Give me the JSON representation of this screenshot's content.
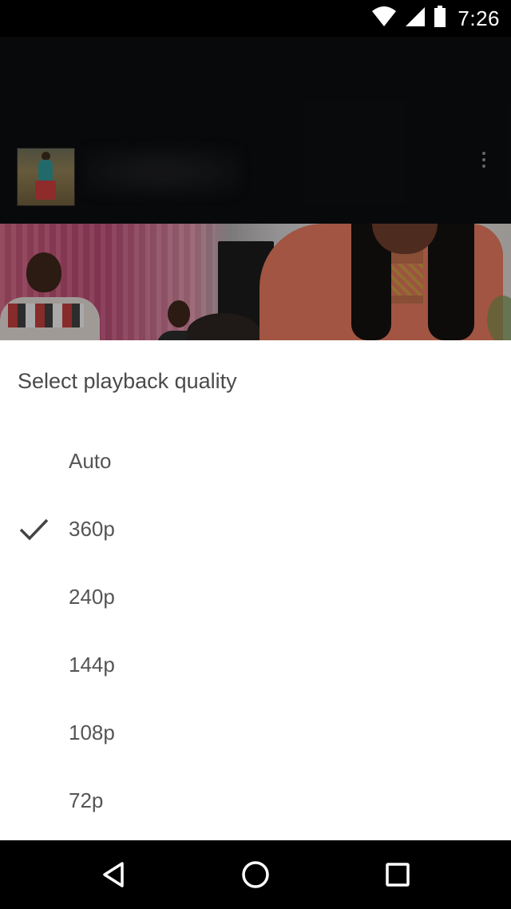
{
  "status_bar": {
    "time": "7:26"
  },
  "quality_sheet": {
    "title": "Select playback quality",
    "selected": "360p",
    "options": [
      {
        "label": "Auto",
        "selected": false
      },
      {
        "label": "360p",
        "selected": true
      },
      {
        "label": "240p",
        "selected": false
      },
      {
        "label": "144p",
        "selected": false
      },
      {
        "label": "108p",
        "selected": false
      },
      {
        "label": "72p",
        "selected": false
      }
    ]
  },
  "icons": {
    "status": [
      "wifi-icon",
      "cellular-signal-icon",
      "battery-icon"
    ],
    "header": [
      "more-vert-icon"
    ],
    "option_selected": "check-icon",
    "nav": [
      "back-icon",
      "home-icon",
      "recents-icon"
    ]
  },
  "colors": {
    "sheet_background": "#ffffff",
    "text": "#555555",
    "check": "#444444",
    "system_bars": "#000000"
  }
}
